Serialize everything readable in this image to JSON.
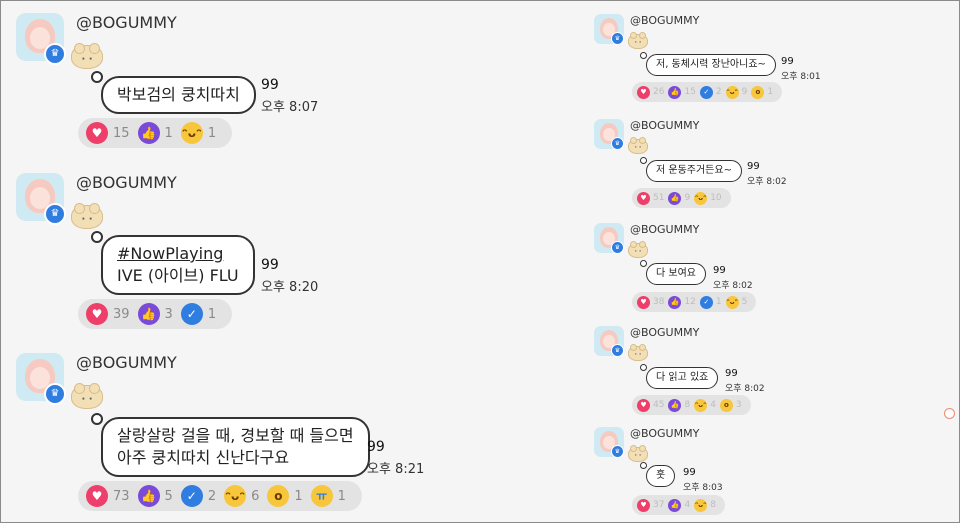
{
  "messages": [
    {
      "sender": "@BOGUMMY",
      "text": [
        "박보검의 쿵치따치"
      ],
      "unread": "99",
      "time": "오후 8:07",
      "reactions": [
        {
          "icon": "heart-icon",
          "count": "15"
        },
        {
          "icon": "thumbs-up-icon",
          "count": "1"
        },
        {
          "icon": "laugh-icon",
          "count": "1"
        }
      ]
    },
    {
      "sender": "@BOGUMMY",
      "text": [
        "#NowPlaying",
        "IVE (아이브) FLU"
      ],
      "unread": "99",
      "time": "오후 8:20",
      "reactions": [
        {
          "icon": "heart-icon",
          "count": "39"
        },
        {
          "icon": "thumbs-up-icon",
          "count": "3"
        },
        {
          "icon": "check-icon",
          "count": "1"
        }
      ]
    },
    {
      "sender": "@BOGUMMY",
      "text": [
        "살랑살랑 걸을 때, 경보할 때 들으면",
        "아주 쿵치따치 신난다구요"
      ],
      "unread": "99",
      "time": "오후 8:21",
      "reactions": [
        {
          "icon": "heart-icon",
          "count": "73"
        },
        {
          "icon": "thumbs-up-icon",
          "count": "5"
        },
        {
          "icon": "check-icon",
          "count": "2"
        },
        {
          "icon": "laugh-icon",
          "count": "6"
        },
        {
          "icon": "wow-icon",
          "count": "1"
        },
        {
          "icon": "cry-icon",
          "count": "1"
        }
      ]
    },
    {
      "sender": "@BOGUMMY",
      "text": [
        "저, 동체시력 장난아니죠~"
      ],
      "unread": "99",
      "time": "오후 8:01",
      "reactions": [
        {
          "icon": "heart-icon",
          "count": "26"
        },
        {
          "icon": "thumbs-up-icon",
          "count": "15"
        },
        {
          "icon": "check-icon",
          "count": "2"
        },
        {
          "icon": "laugh-icon",
          "count": "9"
        },
        {
          "icon": "wow-icon",
          "count": "1"
        }
      ]
    },
    {
      "sender": "@BOGUMMY",
      "text": [
        "저 운동주거든요~"
      ],
      "unread": "99",
      "time": "오후 8:02",
      "reactions": [
        {
          "icon": "heart-icon",
          "count": "51"
        },
        {
          "icon": "thumbs-up-icon",
          "count": "9"
        },
        {
          "icon": "laugh-icon",
          "count": "10"
        }
      ]
    },
    {
      "sender": "@BOGUMMY",
      "text": [
        "다 보여요"
      ],
      "unread": "99",
      "time": "오후 8:02",
      "reactions": [
        {
          "icon": "heart-icon",
          "count": "38"
        },
        {
          "icon": "thumbs-up-icon",
          "count": "12"
        },
        {
          "icon": "check-icon",
          "count": "1"
        },
        {
          "icon": "laugh-icon",
          "count": "5"
        }
      ]
    },
    {
      "sender": "@BOGUMMY",
      "text": [
        "다 읽고 있죠"
      ],
      "unread": "99",
      "time": "오후 8:02",
      "reactions": [
        {
          "icon": "heart-icon",
          "count": "45"
        },
        {
          "icon": "thumbs-up-icon",
          "count": "8"
        },
        {
          "icon": "laugh-icon",
          "count": "4"
        },
        {
          "icon": "wow-icon",
          "count": "3"
        }
      ]
    },
    {
      "sender": "@BOGUMMY",
      "text": [
        "훗"
      ],
      "unread": "99",
      "time": "오후 8:03",
      "reactions": [
        {
          "icon": "heart-icon",
          "count": "37"
        },
        {
          "icon": "thumbs-up-icon",
          "count": "4"
        },
        {
          "icon": "laugh-icon",
          "count": "8"
        }
      ]
    }
  ],
  "colors": {
    "heart": "#ee3e6a",
    "thumbs_up": "#7a4ad8",
    "check": "#2f7de1",
    "laugh": "#f7c63a",
    "background": "#f5f5f5"
  }
}
